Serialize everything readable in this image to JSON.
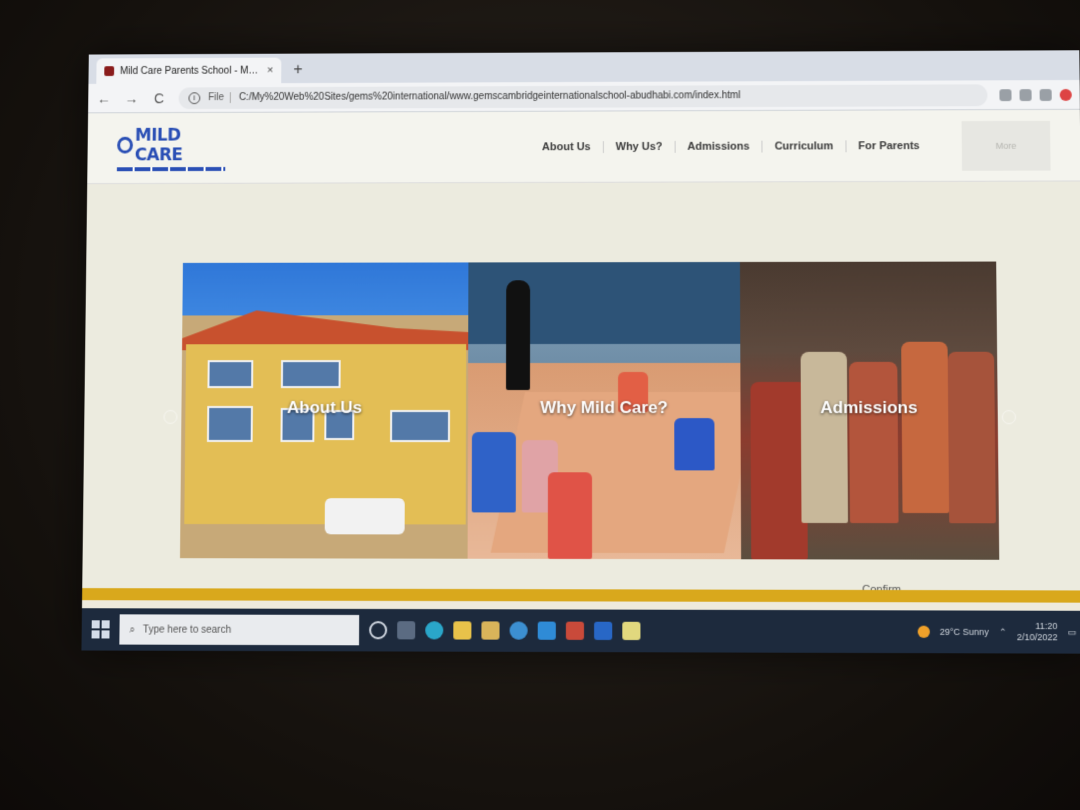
{
  "browser": {
    "tab_title": "Mild Care Parents School - Muny",
    "tab_close": "×",
    "new_tab": "+",
    "back": "←",
    "forward": "→",
    "reload": "C",
    "file_label": "File",
    "url": "C:/My%20Web%20Sites/gems%20international/www.gemscambridgeinternationalschool-abudhabi.com/index.html"
  },
  "site": {
    "logo_text": "MILD CARE",
    "nav": [
      "About Us",
      "Why Us?",
      "Admissions",
      "Curriculum",
      "For Parents"
    ],
    "more": "More"
  },
  "slider": {
    "panels": [
      {
        "caption": "About Us"
      },
      {
        "caption": "Why Mild Care?"
      },
      {
        "caption": "Admissions"
      }
    ]
  },
  "confirm_label": "Confirm",
  "taskbar": {
    "search_placeholder": "Type here to search",
    "weather": "29°C  Sunny",
    "time": "11:20",
    "date": "2/10/2022"
  },
  "colors": {
    "accent_gold": "#d9a81c",
    "logo_blue": "#2a4fb5",
    "taskbar": "#1d2a3d"
  }
}
